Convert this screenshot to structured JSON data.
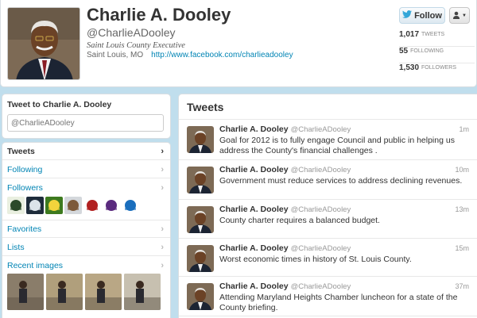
{
  "profile": {
    "name": "Charlie A. Dooley",
    "handle": "@CharlieADooley",
    "bio": "Saint Louis County Executive",
    "location": "Saint Louis, MO",
    "url": "http://www.facebook.com/charlieadooley",
    "follow_label": "Follow",
    "stats": [
      {
        "count": "1,017",
        "label": "TWEETS"
      },
      {
        "count": "55",
        "label": "FOLLOWING"
      },
      {
        "count": "1,530",
        "label": "FOLLOWERS"
      }
    ]
  },
  "tweet_to": {
    "title": "Tweet to Charlie A. Dooley",
    "placeholder": "@CharlieADooley"
  },
  "nav": {
    "tweets": "Tweets",
    "following": "Following",
    "followers": "Followers",
    "favorites": "Favorites",
    "lists": "Lists",
    "recent_images": "Recent images"
  },
  "follower_thumbs": [
    {
      "color": "#e9efe0",
      "accent": "#2c4a2a"
    },
    {
      "color": "#1e2c3b",
      "accent": "#dce4ea"
    },
    {
      "color": "#3d7a1f",
      "accent": "#f2d43c"
    },
    {
      "color": "#d4d8dc",
      "accent": "#7d5a3a"
    },
    {
      "color": "#ffffff",
      "accent": "#b12020"
    },
    {
      "color": "#ffffff",
      "accent": "#5a2a7e"
    },
    {
      "color": "#ffffff",
      "accent": "#1a6ebd"
    }
  ],
  "recent_images_colors": [
    "#8a7d6a",
    "#b09f7c",
    "#b9a785",
    "#c7c0b0"
  ],
  "tweets_header": "Tweets",
  "tweets": [
    {
      "name": "Charlie A. Dooley",
      "handle": "@CharlieADooley",
      "time": "1m",
      "text": "Goal for 2012 is to fully engage Council and public in helping us address the County's financial challenges ."
    },
    {
      "name": "Charlie A. Dooley",
      "handle": "@CharlieADooley",
      "time": "10m",
      "text": "Government must reduce services to address declining revenues."
    },
    {
      "name": "Charlie A. Dooley",
      "handle": "@CharlieADooley",
      "time": "13m",
      "text": "County charter requires a balanced budget."
    },
    {
      "name": "Charlie A. Dooley",
      "handle": "@CharlieADooley",
      "time": "15m",
      "text": "Worst economic times in history of St. Louis County."
    },
    {
      "name": "Charlie A. Dooley",
      "handle": "@CharlieADooley",
      "time": "37m",
      "text": "Attending Maryland Heights Chamber luncheon for a state of the County briefing."
    }
  ]
}
